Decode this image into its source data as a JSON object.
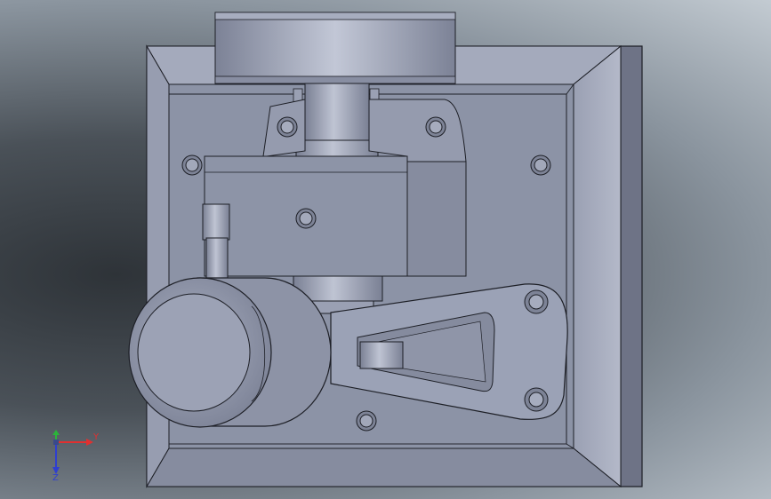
{
  "viewport": {
    "colors": {
      "plate": "#8c93a6",
      "plate_dark": "#5f6576",
      "rim_light": "#aab0c2",
      "rim_dark": "#6c7183",
      "part": "#9ba2b6",
      "part_light": "#b9bfcf",
      "edge": "#1d1f26",
      "background_dark": "#2e3338",
      "background_light": "#c3cbd2"
    }
  },
  "triad": {
    "y_label": "Y",
    "z_label": "Z",
    "y_color": "#e03030",
    "z_color": "#2f3fd0",
    "x_color": "#2bb43a"
  }
}
